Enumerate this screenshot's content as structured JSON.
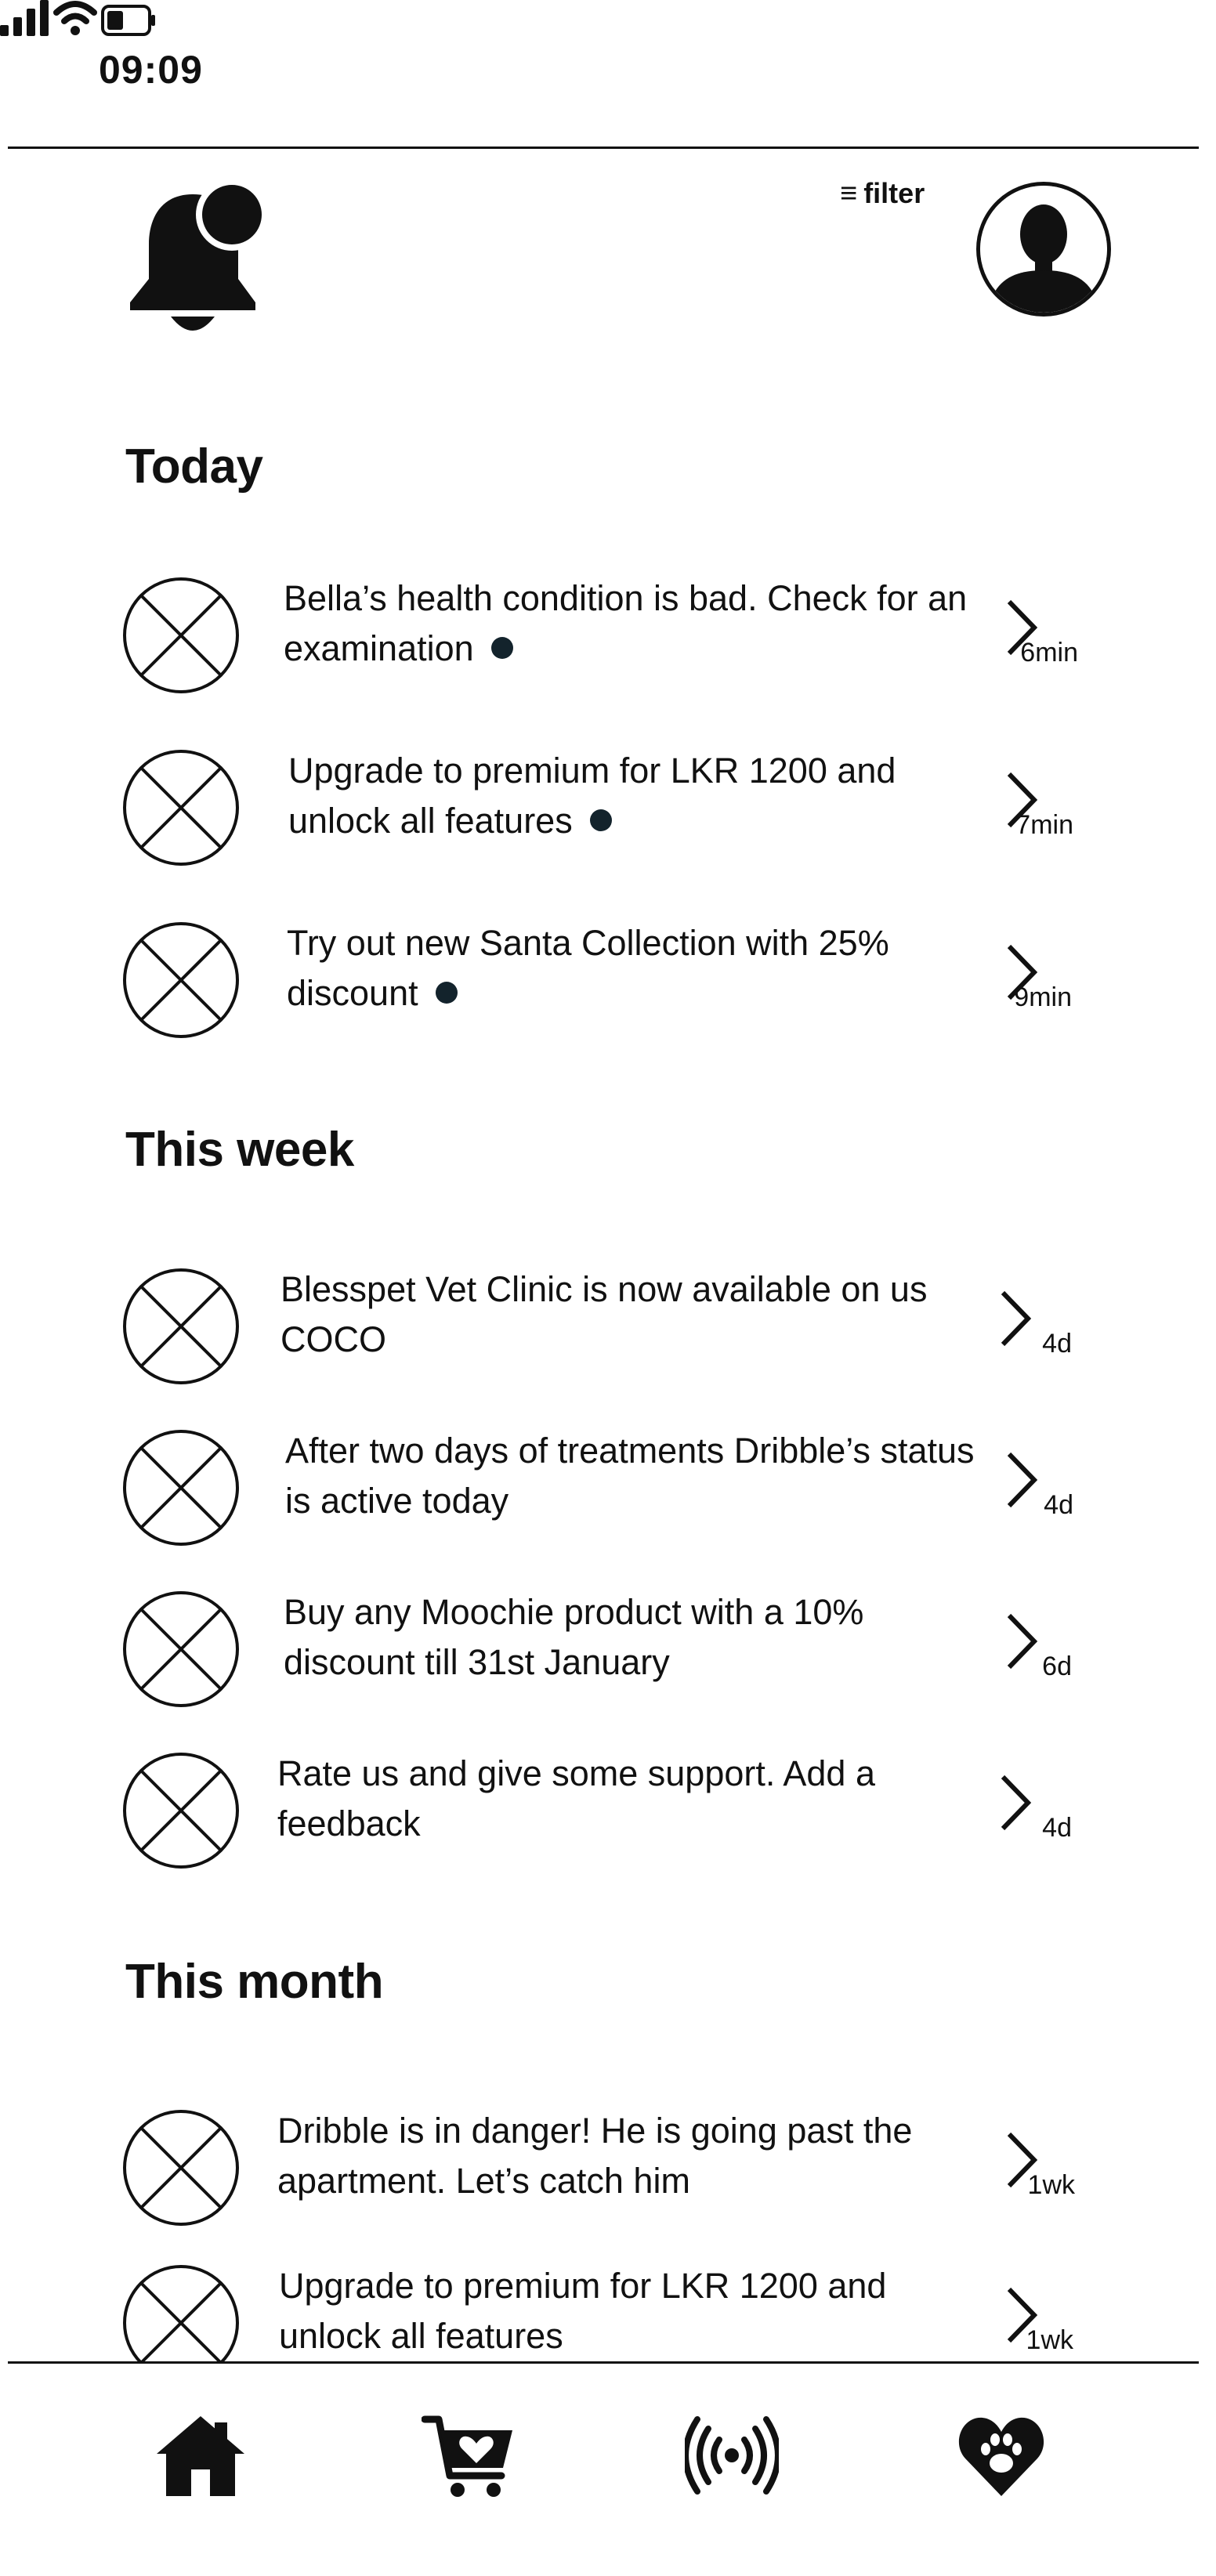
{
  "status_bar": {
    "time": "09:09",
    "icons": [
      "signal-icon",
      "wifi-icon",
      "battery-icon"
    ]
  },
  "header": {
    "bell_icon": "bell-icon",
    "filter_label": "filter",
    "filter_icon": "≡",
    "avatar_icon": "avatar-icon"
  },
  "sections": {
    "today": "Today",
    "this_week": "This week",
    "this_month": "This month"
  },
  "notifications": [
    {
      "text": "Bella’s health condition is bad. Check for an examination",
      "time": "6min",
      "unread": true
    },
    {
      "text": "Upgrade to premium for LKR 1200 and unlock all features",
      "time": "7min",
      "unread": true
    },
    {
      "text": "Try out new Santa Collection with 25% discount",
      "time": "9min",
      "unread": true
    },
    {
      "text": "Blesspet Vet Clinic is now available on  us COCO",
      "time": "4d",
      "unread": false
    },
    {
      "text": "After two days of treatments Dribble’s status is active today",
      "time": "4d",
      "unread": false
    },
    {
      "text": "Buy any Moochie product with a 10% discount till 31st January",
      "time": "6d",
      "unread": false
    },
    {
      "text": "Rate us and give some support. Add a feedback",
      "time": "4d",
      "unread": false
    },
    {
      "text": "Dribble is in danger! He is going past the apartment. Let’s catch him",
      "time": "1wk",
      "unread": false
    },
    {
      "text": "Upgrade to premium for LKR 1200 and unlock all features",
      "time": "1wk",
      "unread": false
    }
  ],
  "bottom_nav": [
    "home-icon",
    "cart-heart-icon",
    "broadcast-icon",
    "paw-heart-icon"
  ],
  "colors": {
    "text": "#111111",
    "dot": "#13232c",
    "background": "#ffffff"
  }
}
